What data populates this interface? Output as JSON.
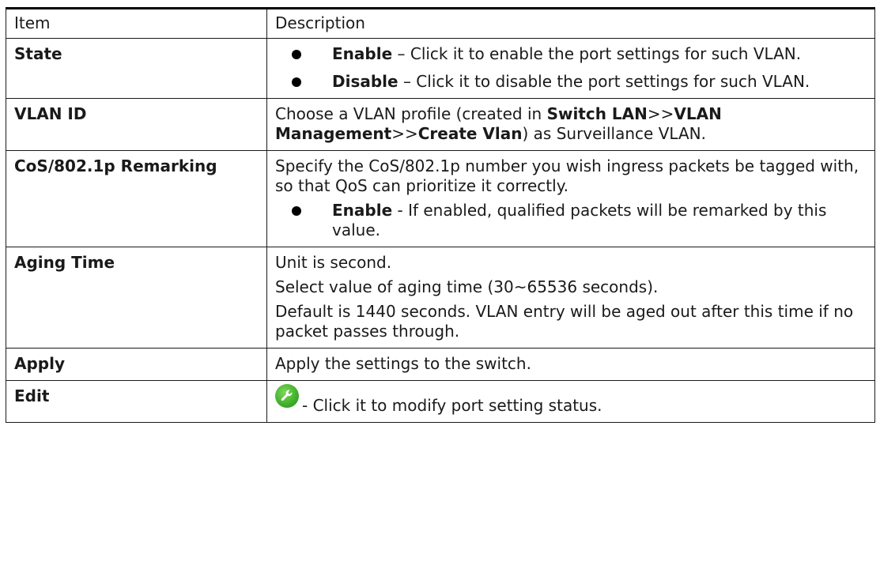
{
  "table": {
    "header": {
      "item": "Item",
      "description": "Description"
    },
    "state": {
      "item": "State",
      "bullets": [
        {
          "term": "Enable",
          "text": " – Click it to enable the port settings for such VLAN."
        },
        {
          "term": "Disable",
          "text": " – Click it to disable the port settings for such VLAN."
        }
      ]
    },
    "vlan_id": {
      "item": "VLAN ID",
      "t1": "Choose a VLAN profile (created in ",
      "b1": "Switch LAN",
      "t2": ">>",
      "b2": "VLAN Management",
      "t3": ">>",
      "b3": "Create Vlan",
      "t4": ") as Surveillance VLAN."
    },
    "cos": {
      "item": "CoS/802.1p Remarking",
      "text": "Specify the CoS/802.1p number you wish ingress packets be tagged with, so that QoS can prioritize it correctly.",
      "bullet_term": "Enable",
      "bullet_text": " - If enabled, qualified packets will be remarked by this value."
    },
    "aging": {
      "item": "Aging Time",
      "lines": [
        "Unit is second.",
        "Select value of aging time (30~65536 seconds).",
        "Default is 1440 seconds. VLAN entry will be aged out after this time if no packet passes through."
      ]
    },
    "apply": {
      "item": "Apply",
      "text": "Apply the settings to the switch."
    },
    "edit": {
      "item": "Edit",
      "icon": "wrench-icon",
      "text": "- Click it to modify port setting status."
    }
  }
}
